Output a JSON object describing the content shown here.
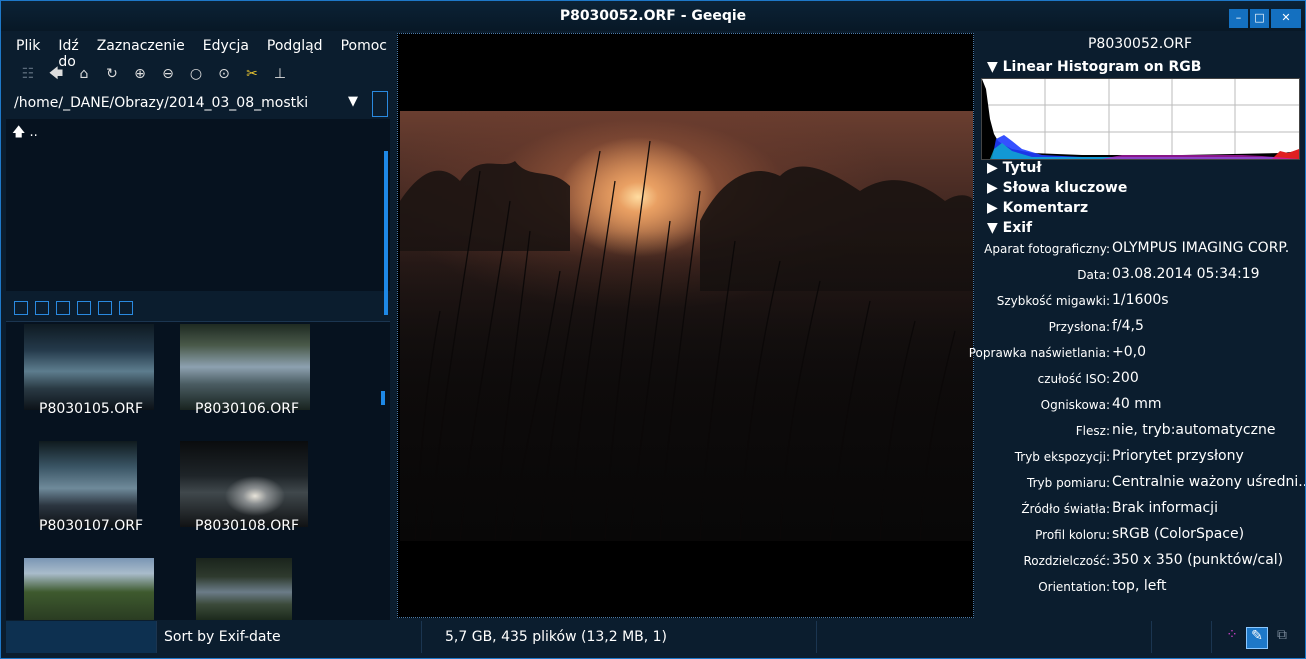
{
  "window": {
    "title": "P8030052.ORF - Geeqie",
    "buttons": {
      "minimize": "–",
      "maximize": "□",
      "close": "✕"
    }
  },
  "menu": [
    "Plik",
    "Idź do",
    "Zaznaczenie",
    "Edycja",
    "Podgląd",
    "Pomoc"
  ],
  "toolbar": {
    "icons": [
      "thumbnails-icon",
      "back-icon",
      "home-icon",
      "refresh-icon",
      "zoom-in-icon",
      "zoom-out-icon",
      "zoom-1-1-icon",
      "zoom-fit-icon",
      "settings-icon",
      "float-icon"
    ]
  },
  "path": {
    "value": "/home/_DANE/Obrazy/2014_03_08_mostki",
    "dropdown_arrow": "▼"
  },
  "dirlist": {
    "items": [
      {
        "icon": "🡅",
        "label": ".."
      }
    ]
  },
  "thumbnails": [
    {
      "label": "P8030105.ORF"
    },
    {
      "label": "P8030106.ORF"
    },
    {
      "label": "P8030107.ORF"
    },
    {
      "label": "P8030108.ORF"
    },
    {
      "label": ""
    },
    {
      "label": ""
    }
  ],
  "info_panel": {
    "filename": "P8030052.ORF",
    "histogram_title": "▼ Linear Histogram on RGB",
    "sections": {
      "title": "▶ Tytuł",
      "keywords": "▶ Słowa kluczowe",
      "comment": "▶ Komentarz",
      "exif": "▼ Exif"
    },
    "exif": [
      {
        "key": "Aparat fotograficzny:",
        "value": "OLYMPUS IMAGING CORP."
      },
      {
        "key": "Data:",
        "value": "03.08.2014 05:34:19"
      },
      {
        "key": "Szybkość migawki:",
        "value": "1/1600s"
      },
      {
        "key": "Przysłona:",
        "value": "f/4,5"
      },
      {
        "key": "Poprawka naświetlania:",
        "value": "+0,0"
      },
      {
        "key": "czułość ISO:",
        "value": "200"
      },
      {
        "key": "Ogniskowa:",
        "value": "40 mm"
      },
      {
        "key": "Flesz:",
        "value": "nie, tryb:automatyczne"
      },
      {
        "key": "Tryb ekspozycji:",
        "value": "Priorytet przysłony"
      },
      {
        "key": "Tryb pomiaru:",
        "value": "Centralnie ważony uśredni..."
      },
      {
        "key": "Źródło światła:",
        "value": "Brak informacji"
      },
      {
        "key": "Profil koloru:",
        "value": "sRGB (ColorSpace)"
      },
      {
        "key": "Rozdzielczość:",
        "value": "350 x 350 (punktów/cal)"
      },
      {
        "key": "Orientation:",
        "value": "top, left"
      }
    ]
  },
  "statusbar": {
    "sort": "Sort by Exif-date",
    "info": "5,7 GB, 435 plików (13,2 MB, 1)"
  },
  "colors": {
    "accent": "#1e78c8",
    "background": "#0b1d2e"
  }
}
